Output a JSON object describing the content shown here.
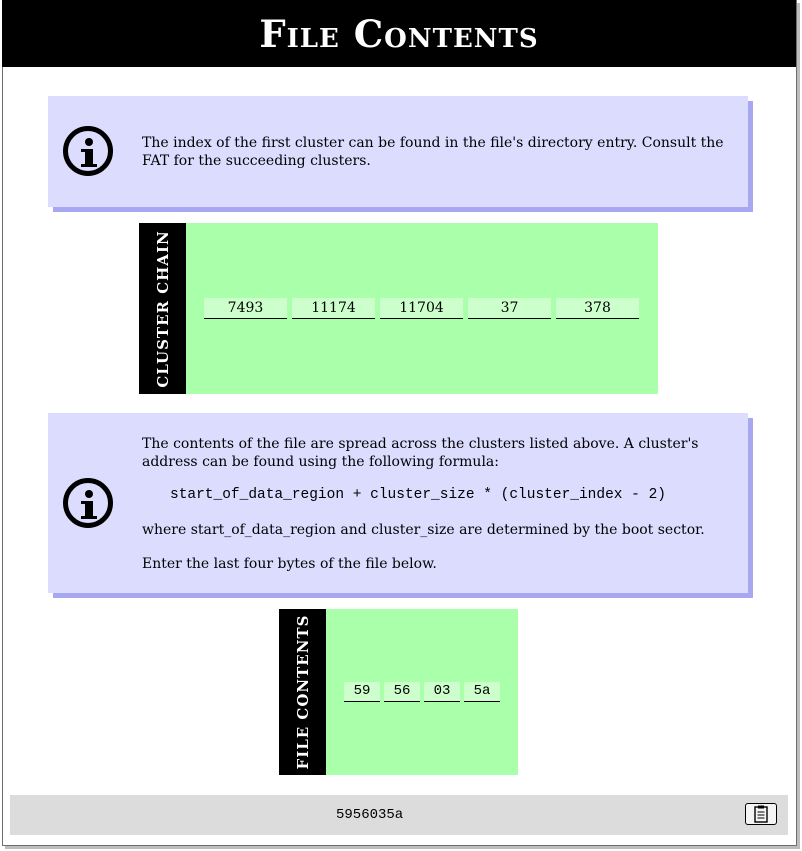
{
  "title": "File Contents",
  "info1": {
    "text": "The index of the first cluster can be found in the file's directory entry. Consult the FAT for the succeeding clusters."
  },
  "cluster_chain": {
    "label": "CLUSTER CHAIN",
    "values": [
      "7493",
      "11174",
      "11704",
      "37",
      "378"
    ]
  },
  "info2": {
    "para1": "The contents of the file are spread across the clusters listed above. A cluster's address can be found using the following formula:",
    "formula": "start_of_data_region + cluster_size * (cluster_index - 2)",
    "para2": "where start_of_data_region and cluster_size are determined by the boot sector.",
    "para3": "Enter the last four bytes of the file below."
  },
  "file_contents": {
    "label": "FILE CONTENTS",
    "bytes": [
      "59",
      "56",
      "03",
      "5a"
    ]
  },
  "result": {
    "value": "5956035a",
    "copy_icon": "clipboard-icon"
  }
}
